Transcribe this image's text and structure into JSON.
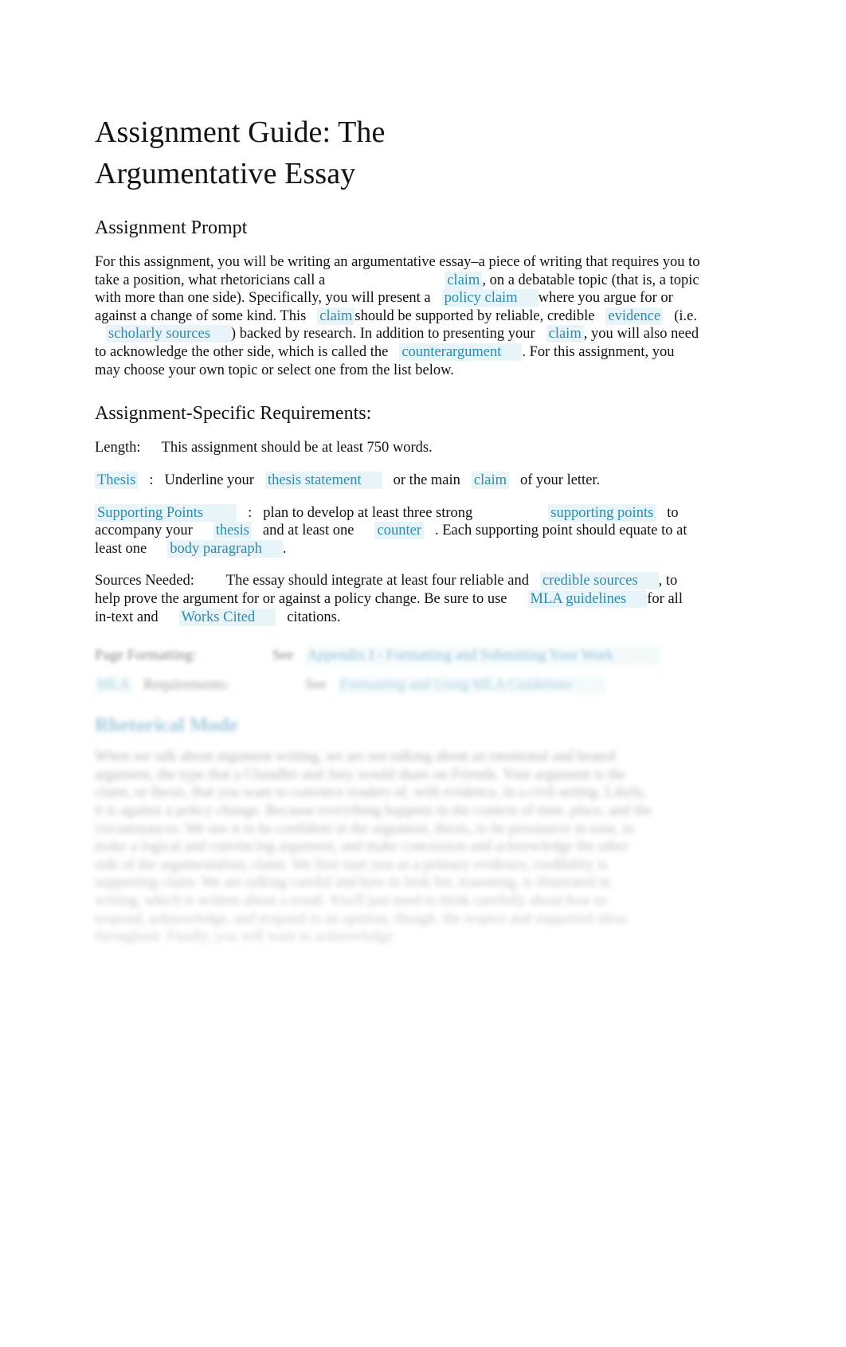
{
  "document": {
    "title": "Assignment Guide: The Argumentative Essay",
    "title_line1": "Assignment Guide: The",
    "title_line2": "Argumentative Essay"
  },
  "colors": {
    "link": "#2b8cb0",
    "link_highlight": "#d6ecf3",
    "text": "#111111",
    "page_background": "#ffffff"
  },
  "prompt_section": {
    "heading": "Assignment Prompt",
    "text_1": "For this assignment, you will be writing an argumentative essay–a piece of writing that requires you to take a position, what rhetoricians call a",
    "link_claim_1": "claim",
    "text_2": ", on a debatable topic (that is, a topic with more than one side). Specifically, you will present a",
    "link_policy_claim": "policy claim",
    "text_3": "where you argue for or against a change of some kind. This",
    "link_claim_2": "claim",
    "text_4": "should be supported by reliable, credible",
    "link_evidence": "evidence",
    "text_5": "(i.e.",
    "link_scholarly_sources": "scholarly sources",
    "text_6": ") backed by research. In addition to presenting your",
    "link_claim_3": "claim",
    "text_7": ", you will also need to acknowledge the other side, which is called the",
    "link_counterargument": "counterargument",
    "text_8": ". For this assignment, you may choose your own topic or select one from the list below."
  },
  "requirements_section": {
    "heading": "Assignment-Specific Requirements:",
    "length": {
      "label": "Length:",
      "value": "This assignment should be at least 750 words."
    },
    "thesis": {
      "link_label": "Thesis",
      "colon": ":",
      "text_1": "Underline your",
      "link_thesis_statement": "thesis statement",
      "text_2": "or the main",
      "link_claim": "claim",
      "text_3": "of your letter."
    },
    "supporting_points": {
      "link_label": "Supporting Points",
      "colon": ":",
      "text_1": "plan to develop at least three strong",
      "link_supporting_points": "supporting points",
      "text_2": "to accompany your",
      "link_thesis": "thesis",
      "text_3": "and at least one",
      "link_counter": "counter",
      "text_4": ". Each supporting point should equate to at least one",
      "link_body_paragraph": "body paragraph",
      "text_5": "."
    },
    "sources_needed": {
      "label": "Sources Needed:",
      "text_1": "The essay should integrate at least four reliable and",
      "link_credible_sources": "credible sources",
      "text_2": ", to help prove the argument for or against a policy change. Be sure to use",
      "link_mla_guidelines": "MLA guidelines",
      "text_3": "for all in-text and",
      "link_works_cited": "Works Cited",
      "text_4": "citations."
    },
    "page_formatting": {
      "label": "Page Formatting:",
      "see": "See",
      "link_appendix": "Appendix I - Formatting and Submitting Your Work"
    },
    "mla_requirements": {
      "link_label": "MLA",
      "label": "Requirements:",
      "see": "See",
      "link_guidelines": "Formatting and Using MLA Guidelines"
    }
  },
  "rhetorical_mode_section": {
    "heading": "Rhetorical Mode",
    "paragraph": "When we talk about argument writing, we are not talking about an emotional and heated argument, the type that a Chandler and Joey would share on Friends. Your argument is the claim, or thesis, that you want to convince readers of, with evidence, in a civil setting. Likely, it is against a policy change. Because everything happens in the context of time, place, and the circumstances. We use it to be confident in the argument, thesis, to be persuasive in tone, to make a logical and convincing argument, and make concession and acknowledge the other side of the argumentation, claim. We first start you as a primary evidence, credibility is supporting claim. We are talking careful and how to look for, reasoning, is illustrated in writing, which is written about a result. You'll just need to think carefully about how to respond, acknowledge, and respond in an opinion, though, the respect and supported ideas throughout. Finally, you will want to acknowledge."
  }
}
